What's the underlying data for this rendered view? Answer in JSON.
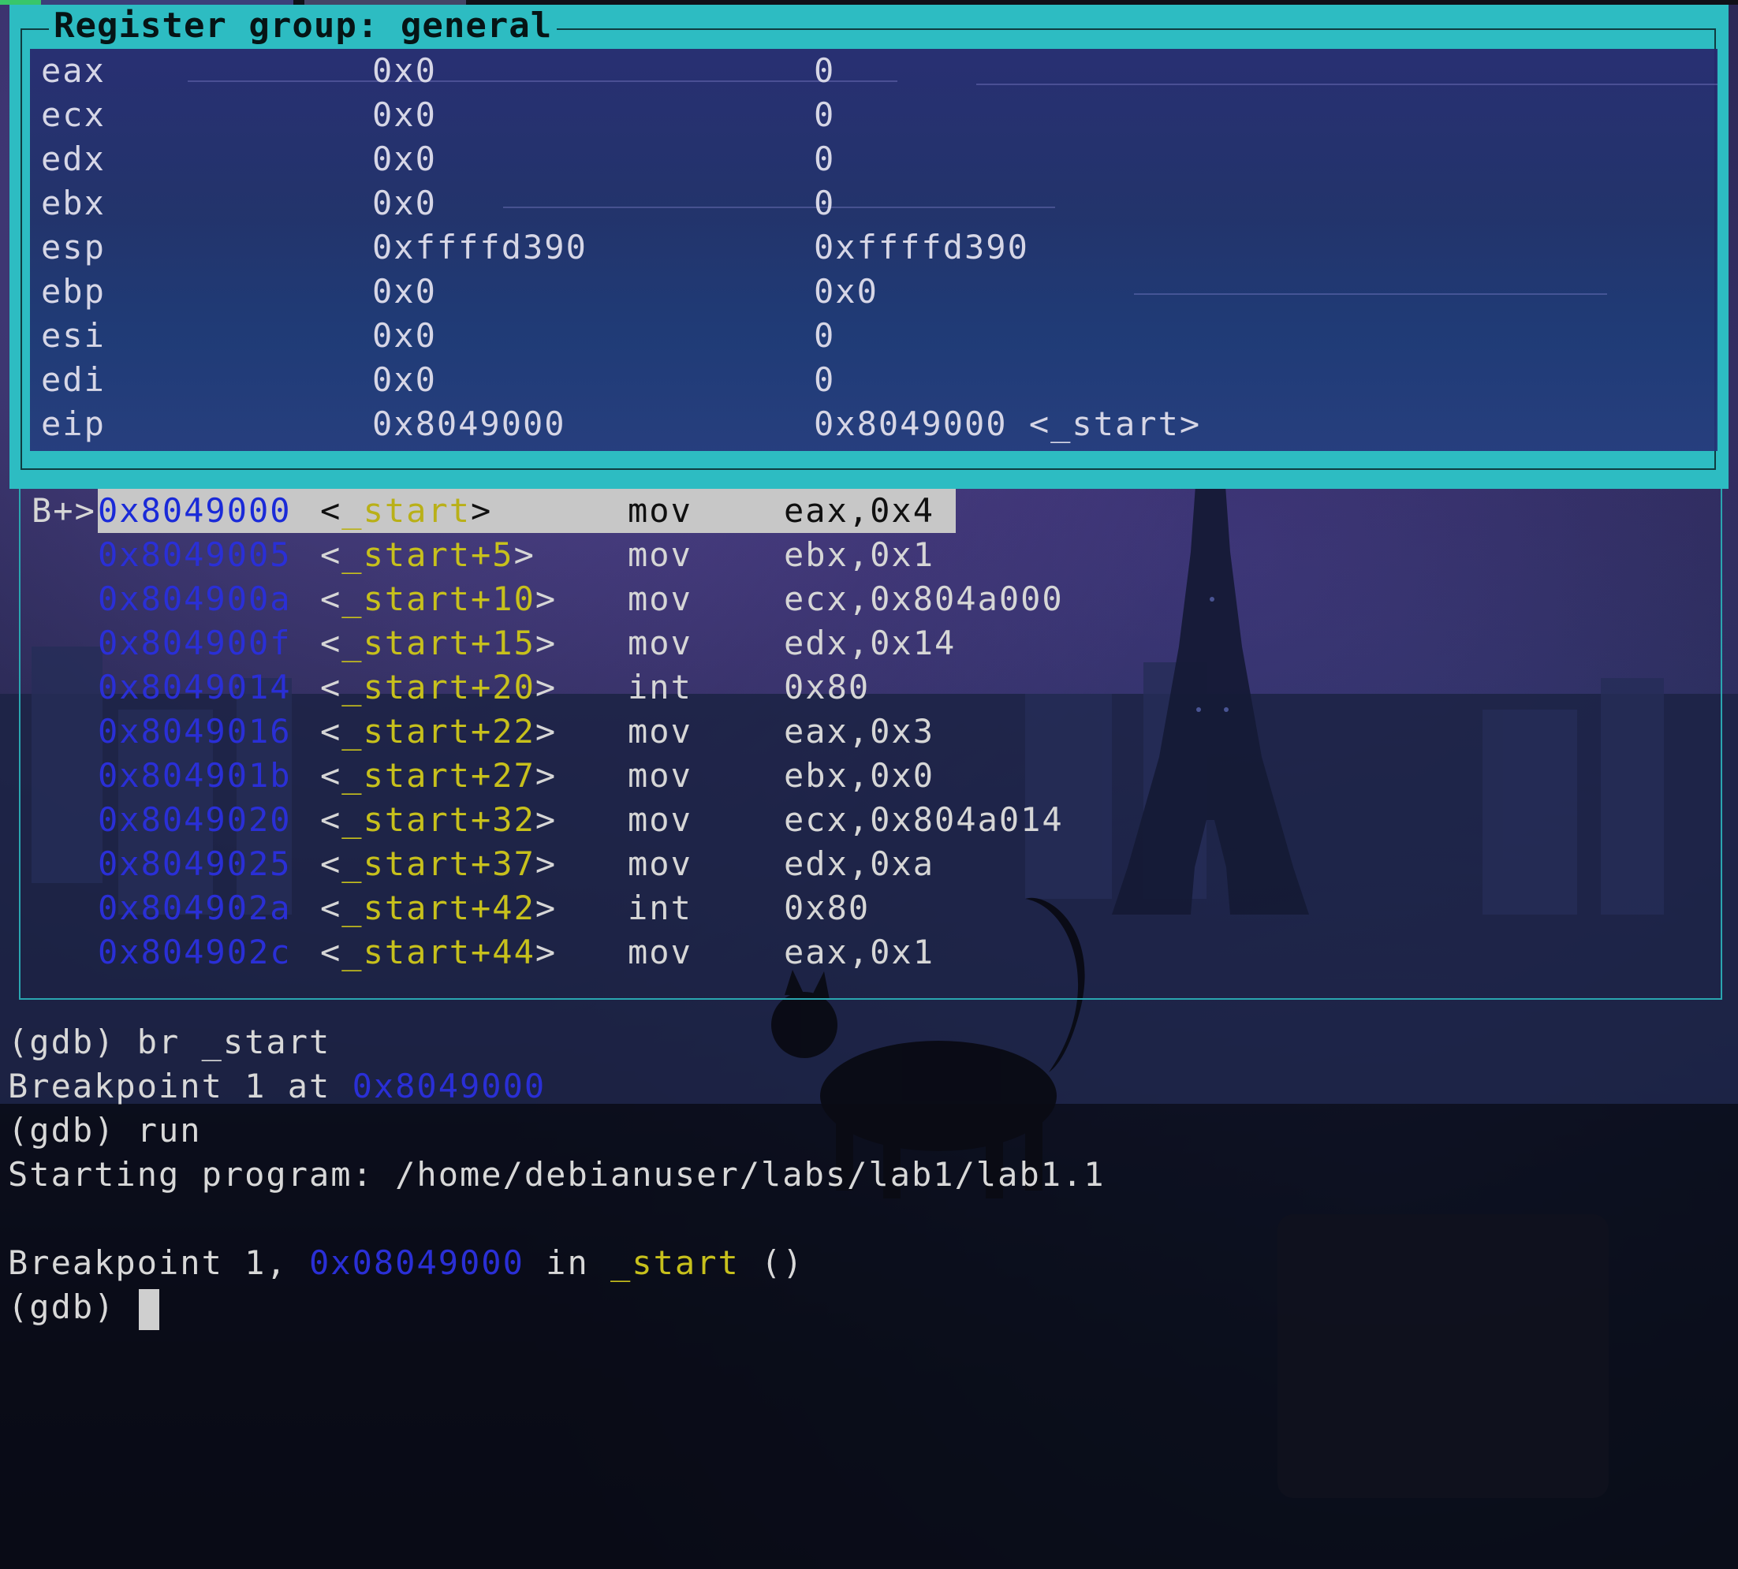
{
  "register_panel": {
    "title": "Register group: general",
    "rows": [
      {
        "name": "eax",
        "hex": "0x0",
        "natural": "0"
      },
      {
        "name": "ecx",
        "hex": "0x0",
        "natural": "0"
      },
      {
        "name": "edx",
        "hex": "0x0",
        "natural": "0"
      },
      {
        "name": "ebx",
        "hex": "0x0",
        "natural": "0"
      },
      {
        "name": "esp",
        "hex": "0xffffd390",
        "natural": "0xffffd390"
      },
      {
        "name": "ebp",
        "hex": "0x0",
        "natural": "0x0"
      },
      {
        "name": "esi",
        "hex": "0x0",
        "natural": "0"
      },
      {
        "name": "edi",
        "hex": "0x0",
        "natural": "0"
      },
      {
        "name": "eip",
        "hex": "0x8049000",
        "natural": "0x8049000 <_start>"
      }
    ]
  },
  "asm_panel": {
    "rows": [
      {
        "marker": "B+>",
        "addr": "0x8049000",
        "sym": "_start",
        "op": "mov",
        "args": "eax,0x4",
        "current": true
      },
      {
        "marker": "",
        "addr": "0x8049005",
        "sym": "_start+5",
        "op": "mov",
        "args": "ebx,0x1"
      },
      {
        "marker": "",
        "addr": "0x804900a",
        "sym": "_start+10",
        "op": "mov",
        "args": "ecx,0x804a000"
      },
      {
        "marker": "",
        "addr": "0x804900f",
        "sym": "_start+15",
        "op": "mov",
        "args": "edx,0x14"
      },
      {
        "marker": "",
        "addr": "0x8049014",
        "sym": "_start+20",
        "op": "int",
        "args": "0x80"
      },
      {
        "marker": "",
        "addr": "0x8049016",
        "sym": "_start+22",
        "op": "mov",
        "args": "eax,0x3"
      },
      {
        "marker": "",
        "addr": "0x804901b",
        "sym": "_start+27",
        "op": "mov",
        "args": "ebx,0x0"
      },
      {
        "marker": "",
        "addr": "0x8049020",
        "sym": "_start+32",
        "op": "mov",
        "args": "ecx,0x804a014"
      },
      {
        "marker": "",
        "addr": "0x8049025",
        "sym": "_start+37",
        "op": "mov",
        "args": "edx,0xa"
      },
      {
        "marker": "",
        "addr": "0x804902a",
        "sym": "_start+42",
        "op": "int",
        "args": "0x80"
      },
      {
        "marker": "",
        "addr": "0x804902c",
        "sym": "_start+44",
        "op": "mov",
        "args": "eax,0x1"
      }
    ]
  },
  "console": {
    "line1": "(gdb) br _start",
    "line2_prefix": "Breakpoint 1 at ",
    "line2_addr": "0x8049000",
    "line3": "(gdb) run",
    "line4": "Starting program: /home/debianuser/labs/lab1/lab1.1",
    "line6_prefix": "Breakpoint 1, ",
    "line6_addr": "0x08049000",
    "line6_mid": " in ",
    "line6_func": "_start",
    "line6_suffix": " ()",
    "prompt": "(gdb) "
  },
  "colors": {
    "panel_accent": "#2dbcc2",
    "address_blue": "#2a2fd6",
    "symbol_yellow": "#c7c01c",
    "highlight_gray": "#c7c7c7"
  }
}
